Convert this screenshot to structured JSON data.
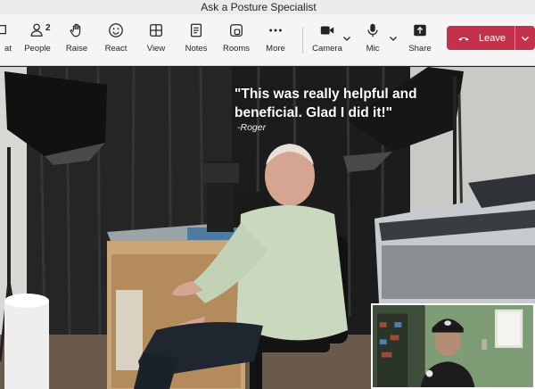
{
  "window": {
    "title": "Ask a Posture Specialist"
  },
  "toolbar": {
    "chat_label": "at",
    "people_label": "People",
    "people_count": "2",
    "raise_label": "Raise",
    "react_label": "React",
    "view_label": "View",
    "notes_label": "Notes",
    "rooms_label": "Rooms",
    "more_label": "More",
    "camera_label": "Camera",
    "mic_label": "Mic",
    "share_label": "Share",
    "leave_label": "Leave",
    "icons": [
      "chat-icon",
      "people-icon",
      "raise-hand-icon",
      "react-icon",
      "view-icon",
      "notes-icon",
      "rooms-icon",
      "more-icon",
      "camera-icon",
      "mic-icon",
      "share-icon",
      "phone-hangup-icon"
    ],
    "leave_color": "#c4314b"
  },
  "stage": {
    "quote": "\"This was really helpful and beneficial.  Glad I did it!\"",
    "author": "-Roger"
  }
}
